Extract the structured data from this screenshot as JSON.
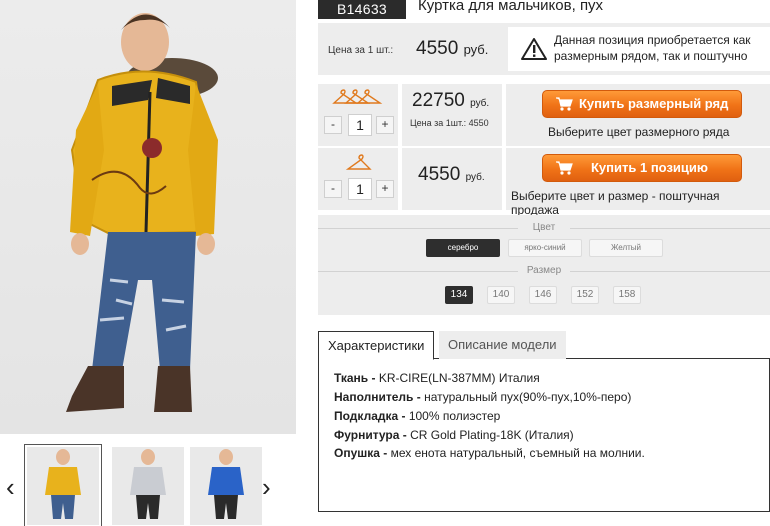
{
  "product": {
    "sku": "B14633",
    "title": "Куртка для мальчиков, пух",
    "price_label": "Цена за 1 шт.:",
    "price": "4550",
    "currency": "руб.",
    "notice": "Данная позиция приобретается как размерным рядом, так и поштучно"
  },
  "purchase_rows": [
    {
      "icon": "size-row-hangers-icon",
      "quantity": "1",
      "price": "22750",
      "currency": "руб.",
      "unit_price_note": "Цена за 1шт.: 4550",
      "button_label": "Купить размерный ряд",
      "hint": "Выберите цвет размерного ряда"
    },
    {
      "icon": "single-hanger-icon",
      "quantity": "1",
      "price": "4550",
      "currency": "руб.",
      "unit_price_note": "",
      "button_label": "Купить 1 позицию",
      "hint": "Выберите цвет и размер - поштучная продажа"
    }
  ],
  "stepper": {
    "minus": "-",
    "plus": "+"
  },
  "options": {
    "color_title": "Цвет",
    "colors": [
      {
        "label": "серебро",
        "selected": true
      },
      {
        "label": "ярко-синий",
        "selected": false
      },
      {
        "label": "Желтый",
        "selected": false
      }
    ],
    "size_title": "Размер",
    "sizes": [
      {
        "label": "134",
        "selected": true
      },
      {
        "label": "140",
        "selected": false
      },
      {
        "label": "146",
        "selected": false
      },
      {
        "label": "152",
        "selected": false
      },
      {
        "label": "158",
        "selected": false
      }
    ]
  },
  "tabs": [
    {
      "label": "Характеристики",
      "active": true
    },
    {
      "label": "Описание модели",
      "active": false
    }
  ],
  "specs": [
    {
      "key": "Ткань -",
      "value": " KR-CIRE(LN-387MM) Италия"
    },
    {
      "key": "Наполнитель -",
      "value": " натуральный пух(90%-пух,10%-перо)"
    },
    {
      "key": "Подкладка -",
      "value": " 100% полиэстер"
    },
    {
      "key": "Фурнитура -",
      "value": " CR Gold Plating-18K (Италия)"
    },
    {
      "key": "Опушка -",
      "value": " мех енота натуральный, съемный на молнии."
    }
  ],
  "gallery": {
    "prev": "‹",
    "next": "›",
    "thumbnails": [
      {
        "name": "thumb-yellow-jacket",
        "color": "#e8b21c",
        "active": true
      },
      {
        "name": "thumb-silver-jacket",
        "color": "#c9ccd2",
        "active": false
      },
      {
        "name": "thumb-blue-jacket",
        "color": "#2a63c8",
        "active": false
      }
    ]
  },
  "colors": {
    "accent": "#f07317",
    "dark": "#2b2b2b",
    "panel": "#ededed",
    "jacket": "#e8b21c"
  }
}
